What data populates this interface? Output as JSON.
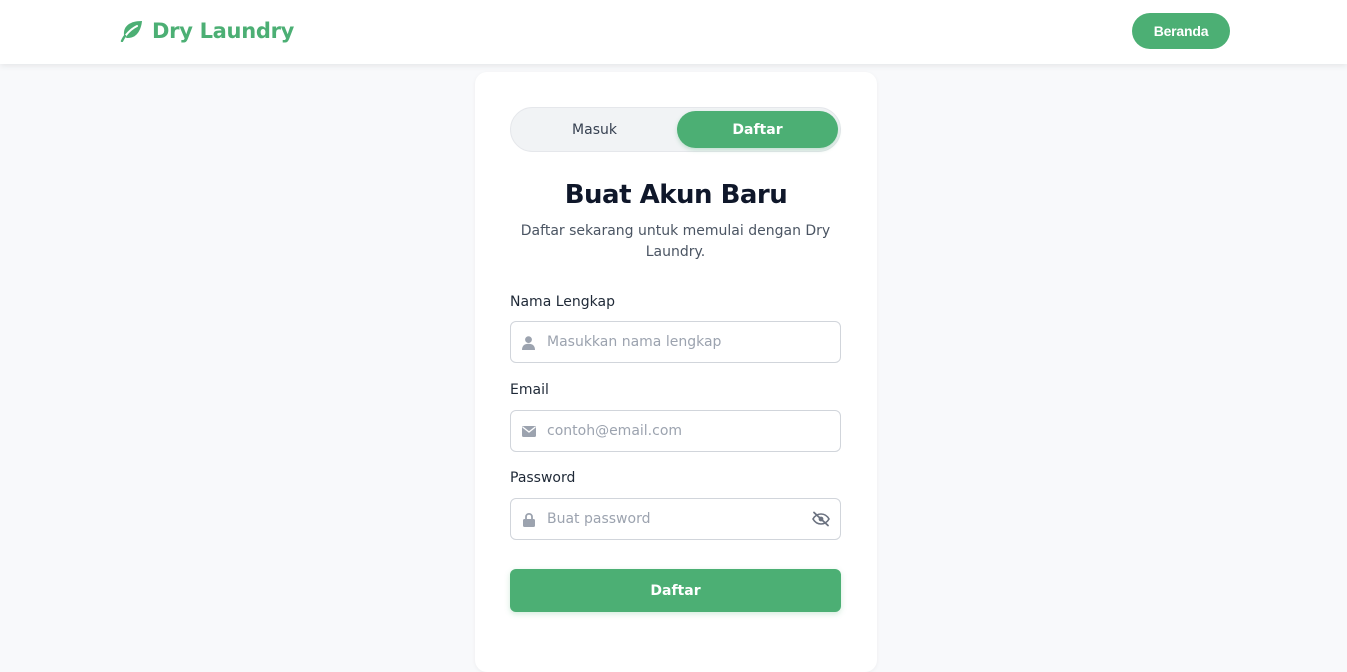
{
  "navbar": {
    "brand_name": "Dry Laundry",
    "home_button": "Beranda",
    "accent_color": "#4caf74"
  },
  "auth": {
    "tabs": [
      "Masuk",
      "Daftar"
    ],
    "active_tab": "Daftar",
    "title": "Buat Akun Baru",
    "subtitle": "Daftar sekarang untuk memulai dengan Dry Laundry.",
    "fields": [
      {
        "label": "Nama Lengkap",
        "placeholder": "Masukkan nama lengkap",
        "value": "",
        "icon": "user-icon"
      },
      {
        "label": "Email",
        "placeholder": "contoh@email.com",
        "value": "",
        "icon": "envelope-icon"
      },
      {
        "label": "Password",
        "placeholder": "Buat password",
        "value": "",
        "icon": "lock-icon",
        "toggle_icon": "eye-slash-icon"
      }
    ],
    "submit_label": "Daftar"
  }
}
